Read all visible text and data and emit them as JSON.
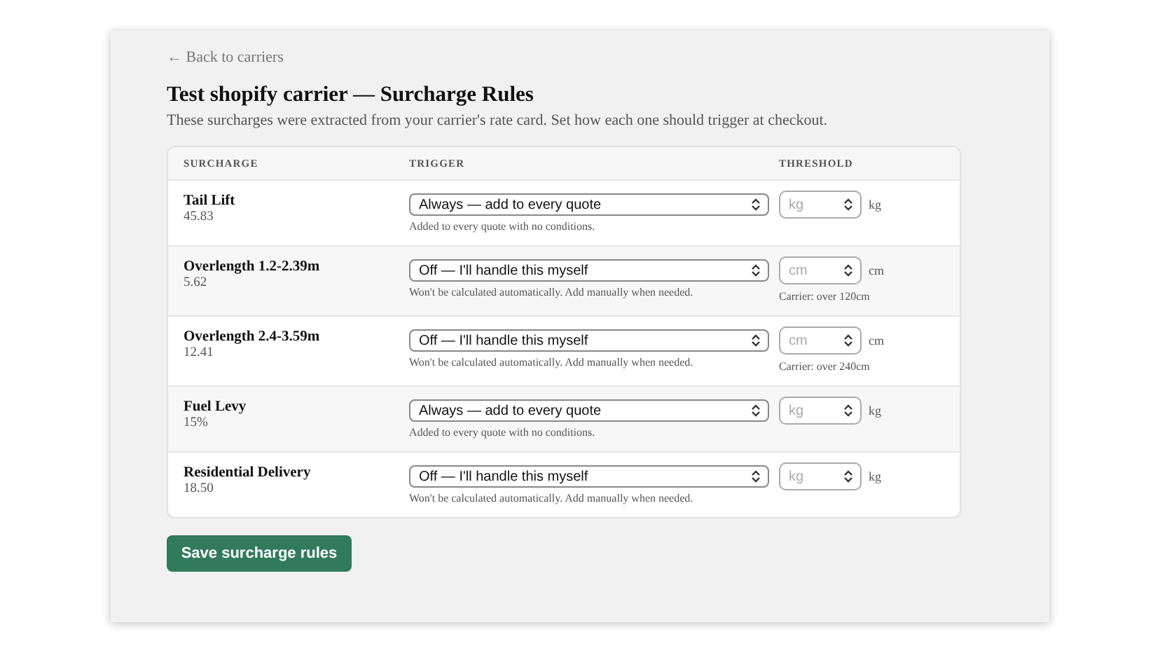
{
  "back_link": "← Back to carriers",
  "title": "Test shopify carrier — Surcharge Rules",
  "description": "These surcharges were extracted from your carrier's rate card. Set how each one should trigger at checkout.",
  "table": {
    "columns": [
      "SURCHARGE",
      "TRIGGER",
      "THRESHOLD"
    ],
    "rows": [
      {
        "name": "Tail Lift",
        "amount": "45.83",
        "trigger": "Always — add to every quote",
        "trigger_note": "Added to every quote with no conditions.",
        "threshold_placeholder": "kg",
        "unit": "kg"
      },
      {
        "name": "Overlength 1.2-2.39m",
        "amount": "5.62",
        "trigger": "Off — I'll handle this myself",
        "trigger_note": "Won't be calculated automatically. Add manually when needed.",
        "threshold_placeholder": "cm",
        "unit": "cm",
        "carrier_note": "Carrier: over 120cm"
      },
      {
        "name": "Overlength 2.4-3.59m",
        "amount": "12.41",
        "trigger": "Off — I'll handle this myself",
        "trigger_note": "Won't be calculated automatically. Add manually when needed.",
        "threshold_placeholder": "cm",
        "unit": "cm",
        "carrier_note": "Carrier: over 240cm"
      },
      {
        "name": "Fuel Levy",
        "amount": "15%",
        "trigger": "Always — add to every quote",
        "trigger_note": "Added to every quote with no conditions.",
        "threshold_placeholder": "kg",
        "unit": "kg"
      },
      {
        "name": "Residential Delivery",
        "amount": "18.50",
        "trigger": "Off — I'll handle this myself",
        "trigger_note": "Won't be calculated automatically. Add manually when needed.",
        "threshold_placeholder": "kg",
        "unit": "kg"
      }
    ]
  },
  "save_button": "Save surcharge rules"
}
